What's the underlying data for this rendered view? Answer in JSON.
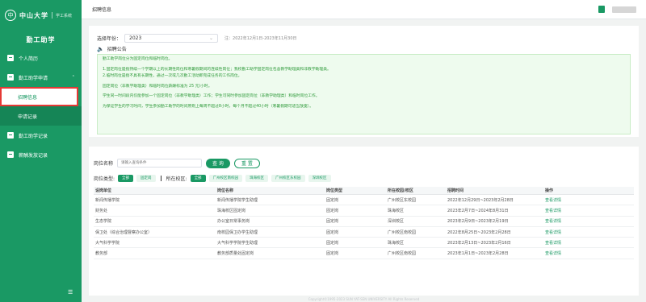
{
  "sidebar": {
    "logo_glyph": "中",
    "school": "中山大学",
    "system": "学工系统",
    "title": "勤工助学",
    "items": [
      {
        "label": "个人简历",
        "icon": "user-icon"
      },
      {
        "label": "勤工助学申请",
        "icon": "apply-icon",
        "caret": "⌃"
      },
      {
        "label": "招聘信息",
        "active": true
      },
      {
        "label": "申请记录"
      },
      {
        "label": "勤工助学记录",
        "icon": "record-icon"
      },
      {
        "label": "薪酬发放记录",
        "icon": "salary-icon"
      }
    ],
    "collapse_glyph": "☰"
  },
  "topbar": {
    "title": "招聘信息"
  },
  "filter_year": {
    "label": "选择年份：",
    "value": "2023",
    "note": "注：2022年12月1日-2023年11月30日"
  },
  "announcement": {
    "title": "招聘公告",
    "lines": [
      "勤工助学岗位分为固定岗位和临时岗位。",
      "1.固定岗位是指持续一个学期以上的长期性岗位和寒暑假期间的连续性岗位；我校勤工助学固定岗位包含教学助理类和非教学助理类。",
      "2.临时岗位是指不具有长期性，通过一次或几次勤工活动即完成任务的工作岗位。",
      "固定岗位（非教学助理类）和临时岗位薪酬标准为 25 元/小时。",
      "学生同一时间段内仅能参加一个固定岗位（非教学助理类）工作；学生可同时参加固定岗位（非教学助理类）和临时岗位工作。",
      "为保证学生的学习时间，学生参加勤工助学的时间原则上每周不超过8小时，每个月不超过40小时（寒暑假期可适当放宽）。"
    ]
  },
  "search": {
    "label": "岗位名称",
    "placeholder": "请输入查询条件",
    "query_label": "查 询",
    "reset_label": "重 置"
  },
  "type_filter": {
    "label": "岗位类型:",
    "tags": [
      {
        "label": "全部",
        "on": true
      },
      {
        "label": "固定岗",
        "on": false
      }
    ]
  },
  "campus_filter": {
    "label": "所在校区:",
    "tags": [
      {
        "label": "全部",
        "on": true
      },
      {
        "label": "广州校区南校园",
        "on": false
      },
      {
        "label": "珠海校区",
        "on": false
      },
      {
        "label": "广州校区东校园",
        "on": false
      },
      {
        "label": "深圳校区",
        "on": false
      }
    ]
  },
  "table": {
    "headers": [
      "设岗单位",
      "岗位名称",
      "岗位类型",
      "所在校园/校区",
      "招聘时间",
      "操作"
    ],
    "rows": [
      [
        "新闻传播学院",
        "新闻传播学院学生助理",
        "固定岗",
        "广州校区东校园",
        "2022年12月29日~2023年2月28日",
        "查看详情"
      ],
      [
        "财务处",
        "珠海校区固定岗",
        "固定岗",
        "珠海校区",
        "2023年2月7日~2024年8月31日",
        "查看详情"
      ],
      [
        "生态学院",
        "办公室日常事务岗",
        "固定岗",
        "深圳校区",
        "2023年2月9日~2023年2月19日",
        "查看详情"
      ],
      [
        "保卫处（综合治理督察办公室）",
        "南校园保卫办学生助理",
        "固定岗",
        "广州校区南校园",
        "2022年8月25日~2023年2月28日",
        "查看详情"
      ],
      [
        "大气科学学院",
        "大气科学学院学生助理",
        "固定岗",
        "珠海校区",
        "2023年2月13日~2023年2月16日",
        "查看详情"
      ],
      [
        "教务部",
        "教务部质量处固定岗",
        "固定岗",
        "广州校区南校园",
        "2023年1月1日~2023年2月28日",
        "查看详情"
      ]
    ]
  },
  "footer": "Copyright©1995-2023 SUN YAT-SEN UNIVERSITY All Rights Reserved",
  "colors": {
    "brand": "#1a9964",
    "notice_text": "#2e9a3a",
    "notice_bg": "#eefbee",
    "highlight": "#e53935"
  }
}
